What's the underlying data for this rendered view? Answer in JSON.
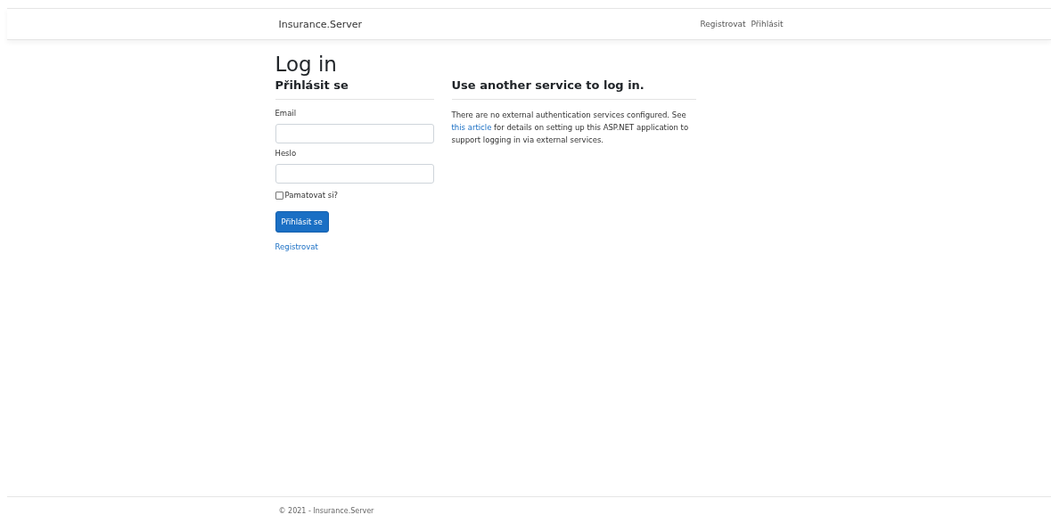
{
  "navbar": {
    "brand": "Insurance.Server",
    "links": [
      {
        "label": "Registrovat"
      },
      {
        "label": "Přihlásit"
      }
    ]
  },
  "page_title": "Log in",
  "login": {
    "heading": "Přihlásit se",
    "fields": [
      {
        "label": "Email"
      },
      {
        "label": "Heslo"
      }
    ],
    "remember": {
      "label": "Pamatovat si?",
      "checked": false
    },
    "submit": "Přihlásit se",
    "register_link": "Registrovat"
  },
  "external": {
    "heading": "Use another service to log in.",
    "text_before": "There are no external authentication services configured. See ",
    "link": "this article",
    "text_after": " for details on setting up this ASP.NET application to support logging in via external services."
  },
  "footer": "© 2021 - Insurance.Server"
}
